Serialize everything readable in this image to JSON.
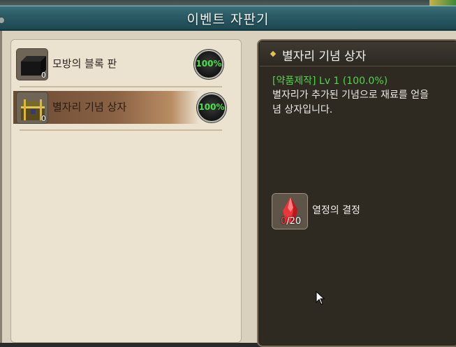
{
  "window": {
    "title": "이벤트 자판기"
  },
  "list": {
    "items": [
      {
        "name": "모방의 블록 판",
        "count": "0",
        "progress": "100%",
        "icon": "block-plate-icon",
        "selected": false
      },
      {
        "name": "별자리 기념 상자",
        "count": "0",
        "progress": "100%",
        "icon": "treasure-chest-icon",
        "selected": true
      }
    ]
  },
  "detail": {
    "title": "별자리 기념 상자",
    "craft_info": "[약품제작] Lv 1 (100.0%)",
    "description_line1": "별자리가 추가된 기념으로 재료를 얻을",
    "description_line2": "념 상자입니다.",
    "material": {
      "name": "열정의 결정",
      "have": "0",
      "need": "/20",
      "icon": "red-crystal-icon"
    }
  },
  "colors": {
    "progress_text": "#49e04a",
    "craft_info": "#52d44e",
    "material_have": "#ff3b3b",
    "title_bar": "#2b5c66"
  }
}
